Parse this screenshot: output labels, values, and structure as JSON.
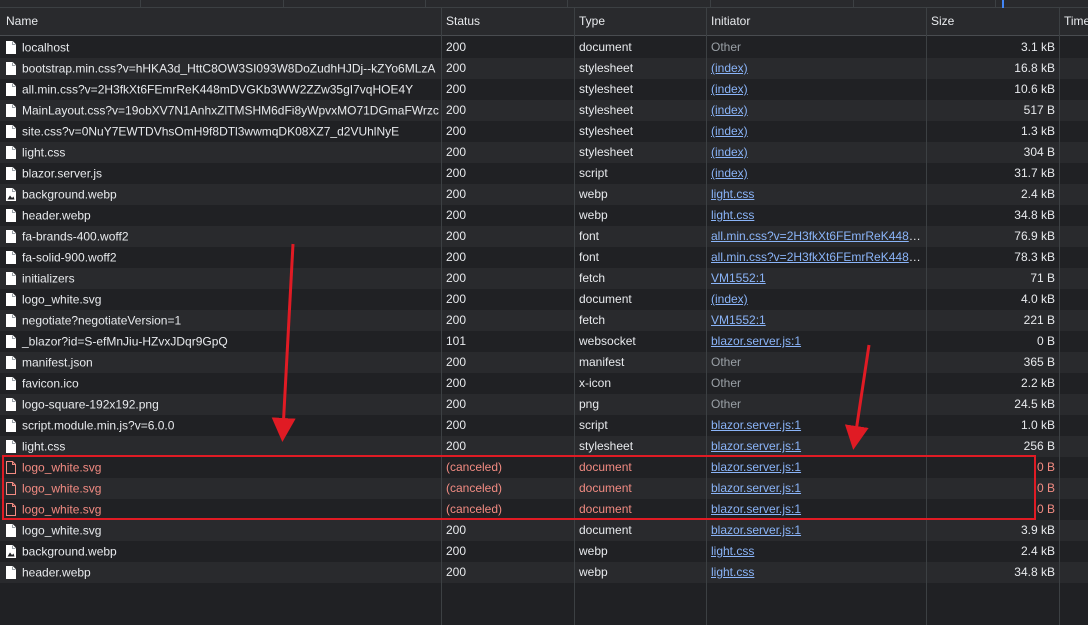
{
  "columns": {
    "name": "Name",
    "status": "Status",
    "type": "Type",
    "initiator": "Initiator",
    "size": "Size",
    "time": "Time"
  },
  "colors": {
    "background": "#202124",
    "row_alt": "#292a2d",
    "link": "#8ab4f8",
    "error_text": "#f28b82",
    "annotation_red": "#e01b24"
  },
  "requests": [
    {
      "name": "localhost",
      "status": "200",
      "type": "document",
      "initiator": "Other",
      "initiator_link": false,
      "size": "3.1 kB",
      "icon": "document-icon"
    },
    {
      "name": "bootstrap.min.css?v=hHKA3d_HttC8OW3SI093W8DoZudhHJDj--kZYo6MLzA",
      "status": "200",
      "type": "stylesheet",
      "initiator": "(index)",
      "initiator_link": true,
      "size": "16.8 kB",
      "icon": "document-icon"
    },
    {
      "name": "all.min.css?v=2H3fkXt6FEmrReK448mDVGKb3WW2ZZw35gI7vqHOE4Y",
      "status": "200",
      "type": "stylesheet",
      "initiator": "(index)",
      "initiator_link": true,
      "size": "10.6 kB",
      "icon": "document-icon"
    },
    {
      "name": "MainLayout.css?v=19obXV7N1AnhxZlTMSHM6dFi8yWpvxMO71DGmaFWrzc",
      "status": "200",
      "type": "stylesheet",
      "initiator": "(index)",
      "initiator_link": true,
      "size": "517 B",
      "icon": "document-icon"
    },
    {
      "name": "site.css?v=0NuY7EWTDVhsOmH9f8DTl3wwmqDK08XZ7_d2VUhlNyE",
      "status": "200",
      "type": "stylesheet",
      "initiator": "(index)",
      "initiator_link": true,
      "size": "1.3 kB",
      "icon": "document-icon"
    },
    {
      "name": "light.css",
      "status": "200",
      "type": "stylesheet",
      "initiator": "(index)",
      "initiator_link": true,
      "size": "304 B",
      "icon": "document-icon"
    },
    {
      "name": "blazor.server.js",
      "status": "200",
      "type": "script",
      "initiator": "(index)",
      "initiator_link": true,
      "size": "31.7 kB",
      "icon": "document-icon"
    },
    {
      "name": "background.webp",
      "status": "200",
      "type": "webp",
      "initiator": "light.css",
      "initiator_link": true,
      "size": "2.4 kB",
      "icon": "image-icon"
    },
    {
      "name": "header.webp",
      "status": "200",
      "type": "webp",
      "initiator": "light.css",
      "initiator_link": true,
      "size": "34.8 kB",
      "icon": "document-icon"
    },
    {
      "name": "fa-brands-400.woff2",
      "status": "200",
      "type": "font",
      "initiator": "all.min.css?v=2H3fkXt6FEmrReK448m...",
      "initiator_link": true,
      "size": "76.9 kB",
      "icon": "document-icon"
    },
    {
      "name": "fa-solid-900.woff2",
      "status": "200",
      "type": "font",
      "initiator": "all.min.css?v=2H3fkXt6FEmrReK448m...",
      "initiator_link": true,
      "size": "78.3 kB",
      "icon": "document-icon"
    },
    {
      "name": "initializers",
      "status": "200",
      "type": "fetch",
      "initiator": "VM1552:1",
      "initiator_link": true,
      "size": "71 B",
      "icon": "document-icon"
    },
    {
      "name": "logo_white.svg",
      "status": "200",
      "type": "document",
      "initiator": "(index)",
      "initiator_link": true,
      "size": "4.0 kB",
      "icon": "document-icon"
    },
    {
      "name": "negotiate?negotiateVersion=1",
      "status": "200",
      "type": "fetch",
      "initiator": "VM1552:1",
      "initiator_link": true,
      "size": "221 B",
      "icon": "document-icon"
    },
    {
      "name": "_blazor?id=S-efMnJiu-HZvxJDqr9GpQ",
      "status": "101",
      "type": "websocket",
      "initiator": "blazor.server.js:1",
      "initiator_link": true,
      "size": "0 B",
      "icon": "document-icon"
    },
    {
      "name": "manifest.json",
      "status": "200",
      "type": "manifest",
      "initiator": "Other",
      "initiator_link": false,
      "size": "365 B",
      "icon": "document-icon"
    },
    {
      "name": "favicon.ico",
      "status": "200",
      "type": "x-icon",
      "initiator": "Other",
      "initiator_link": false,
      "size": "2.2 kB",
      "icon": "document-icon"
    },
    {
      "name": "logo-square-192x192.png",
      "status": "200",
      "type": "png",
      "initiator": "Other",
      "initiator_link": false,
      "size": "24.5 kB",
      "icon": "document-icon"
    },
    {
      "name": "script.module.min.js?v=6.0.0",
      "status": "200",
      "type": "script",
      "initiator": "blazor.server.js:1",
      "initiator_link": true,
      "size": "1.0 kB",
      "icon": "document-icon"
    },
    {
      "name": "light.css",
      "status": "200",
      "type": "stylesheet",
      "initiator": "blazor.server.js:1",
      "initiator_link": true,
      "size": "256 B",
      "icon": "document-icon"
    },
    {
      "name": "logo_white.svg",
      "status": "(canceled)",
      "type": "document",
      "initiator": "blazor.server.js:1",
      "initiator_link": true,
      "size": "0 B",
      "icon": "document-icon",
      "canceled": true
    },
    {
      "name": "logo_white.svg",
      "status": "(canceled)",
      "type": "document",
      "initiator": "blazor.server.js:1",
      "initiator_link": true,
      "size": "0 B",
      "icon": "document-icon",
      "canceled": true
    },
    {
      "name": "logo_white.svg",
      "status": "(canceled)",
      "type": "document",
      "initiator": "blazor.server.js:1",
      "initiator_link": true,
      "size": "0 B",
      "icon": "document-icon",
      "canceled": true
    },
    {
      "name": "logo_white.svg",
      "status": "200",
      "type": "document",
      "initiator": "blazor.server.js:1",
      "initiator_link": true,
      "size": "3.9 kB",
      "icon": "document-icon"
    },
    {
      "name": "background.webp",
      "status": "200",
      "type": "webp",
      "initiator": "light.css",
      "initiator_link": true,
      "size": "2.4 kB",
      "icon": "image-icon"
    },
    {
      "name": "header.webp",
      "status": "200",
      "type": "webp",
      "initiator": "light.css",
      "initiator_link": true,
      "size": "34.8 kB",
      "icon": "document-icon"
    }
  ]
}
